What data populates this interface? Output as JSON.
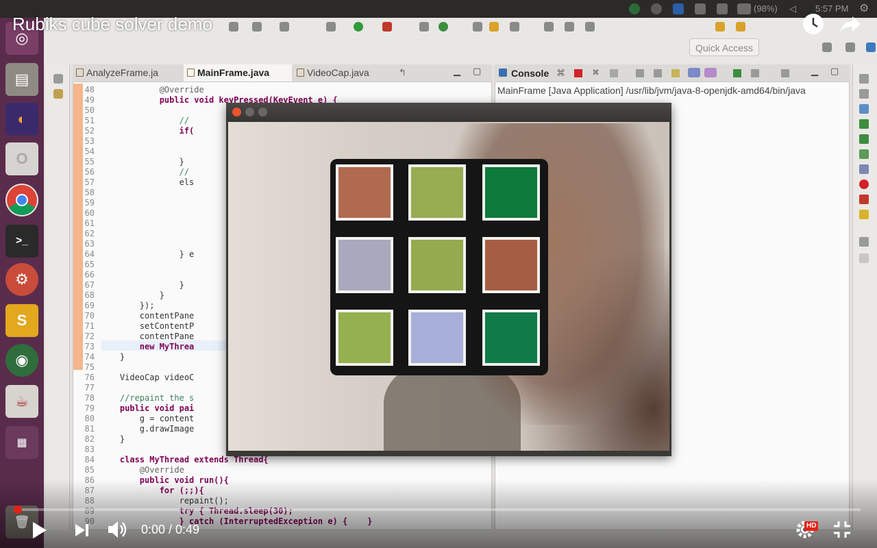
{
  "video": {
    "title": "Rubiks cube solver demo",
    "time_display": "0:00 / 0:49",
    "progress": 0.0,
    "hd_badge": "HD",
    "icons": [
      "watch-later-icon",
      "share-icon",
      "play-icon",
      "next-icon",
      "volume-icon",
      "settings-icon",
      "exit-fullscreen-icon"
    ]
  },
  "system_panel": {
    "battery": "(98%)",
    "clock": "5:57 PM"
  },
  "eclipse": {
    "quick_access": "Quick Access",
    "editor_tabs": [
      "AnalyzeFrame.ja",
      "MainFrame.java",
      "VideoCap.java"
    ],
    "console_tab": "Console",
    "console_line": "MainFrame [Java Application] /usr/lib/jvm/java-8-openjdk-amd64/bin/java",
    "code_lines": [
      {
        "n": "48",
        "text": "            @Override"
      },
      {
        "n": "49",
        "text": "            public void keyPressed(KeyEvent e) {"
      },
      {
        "n": "50",
        "text": ""
      },
      {
        "n": "51",
        "text": "                //"
      },
      {
        "n": "52",
        "text": "                if("
      },
      {
        "n": "53",
        "text": ""
      },
      {
        "n": "54",
        "text": ""
      },
      {
        "n": "55",
        "text": "                }"
      },
      {
        "n": "56",
        "text": "                //"
      },
      {
        "n": "57",
        "text": "                els"
      },
      {
        "n": "58",
        "text": ""
      },
      {
        "n": "59",
        "text": ""
      },
      {
        "n": "60",
        "text": ""
      },
      {
        "n": "61",
        "text": ""
      },
      {
        "n": "62",
        "text": ""
      },
      {
        "n": "63",
        "text": ""
      },
      {
        "n": "64",
        "text": "                } e"
      },
      {
        "n": "65",
        "text": ""
      },
      {
        "n": "66",
        "text": ""
      },
      {
        "n": "67",
        "text": "                }"
      },
      {
        "n": "68",
        "text": "            }"
      },
      {
        "n": "69",
        "text": "        });"
      },
      {
        "n": "70",
        "text": "        contentPane"
      },
      {
        "n": "71",
        "text": "        setContentP"
      },
      {
        "n": "72",
        "text": "        contentPane"
      },
      {
        "n": "73",
        "text": "        new MyThrea"
      },
      {
        "n": "74",
        "text": "    }"
      },
      {
        "n": "75",
        "text": ""
      },
      {
        "n": "76",
        "text": "    VideoCap videoC"
      },
      {
        "n": "77",
        "text": ""
      },
      {
        "n": "78",
        "text": "    //repaint the s"
      },
      {
        "n": "79",
        "text": "    public void pai"
      },
      {
        "n": "80",
        "text": "        g = content"
      },
      {
        "n": "81",
        "text": "        g.drawImage"
      },
      {
        "n": "82",
        "text": "    }"
      },
      {
        "n": "83",
        "text": ""
      },
      {
        "n": "84",
        "text": "    class MyThread extends Thread{"
      },
      {
        "n": "85",
        "text": "        @Override"
      },
      {
        "n": "86",
        "text": "        public void run(){"
      },
      {
        "n": "87",
        "text": "            for (;;){"
      },
      {
        "n": "88",
        "text": "                repaint();"
      },
      {
        "n": "89",
        "text": "                try { Thread.sleep(30);"
      },
      {
        "n": "90",
        "text": "                } catch (InterruptedException e) {    }"
      }
    ]
  },
  "cube": {
    "colors": [
      "#b06a50",
      "#98ac52",
      "#0e7a3a",
      "#a8a9bd",
      "#95aa4e",
      "#a65e43",
      "#94b04f",
      "#a8b0da",
      "#107a48"
    ]
  }
}
